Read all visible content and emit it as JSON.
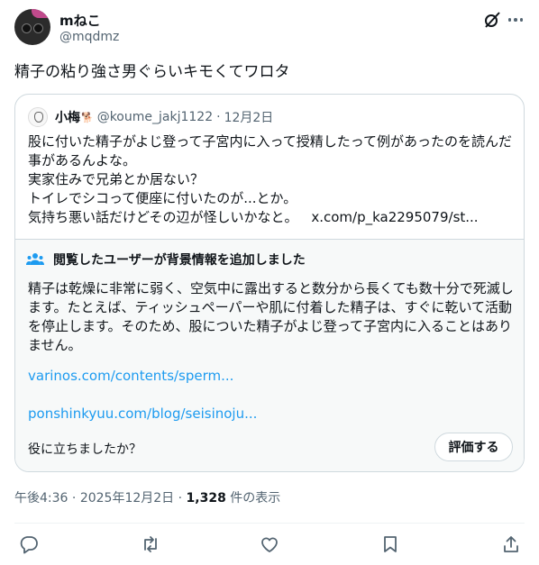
{
  "author": {
    "name": "mねこ",
    "handle": "@mqdmz"
  },
  "tweet": {
    "text": "精子の粘り強さ男ぐらいキモくてワロタ"
  },
  "quote": {
    "name": "小梅",
    "emoji": "🐕",
    "handle": "@koume_jakj1122",
    "dot": "·",
    "date": "12月2日",
    "lines": [
      "股に付いた精子がよじ登って子宮内に入って授精したって例があったのを読んだ",
      "事があるんよな。",
      "実家住みで兄弟とか居ない？",
      "トイレでシコって便座に付いたのが...とか。",
      "気持ち悪い話だけどその辺が怪しいかなと。"
    ],
    "link": "x.com/p_ka2295079/st..."
  },
  "community_note": {
    "header": "閲覧したユーザーが背景情報を追加しました",
    "text": "精子は乾燥に非常に弱く、空気中に露出すると数分から長くても数十分で死滅します。たとえば、ティッシュペーパーや肌に付着した精子は、すぐに乾いて活動を停止します。そのため、股についた精子がよじ登って子宮内に入ることはありません。",
    "links": [
      "varinos.com/contents/sperm...",
      "ponshinkyuu.com/blog/seisinoju..."
    ],
    "helpful_prompt": "役に立ちましたか？",
    "rate_label": "評価する"
  },
  "meta": {
    "time": "午後4:36",
    "dot": "·",
    "date": "2025年12月2日",
    "dot2": "·",
    "views": "1,328",
    "views_label": "件の表示"
  },
  "icons": [
    "grok-icon",
    "more-icon",
    "reply-icon",
    "retweet-icon",
    "like-icon",
    "bookmark-icon",
    "share-icon"
  ],
  "colors": {
    "link": "#1d9bf0",
    "secondary": "#536471",
    "border": "#cfd9de",
    "note_bg": "#f7f9f9"
  }
}
